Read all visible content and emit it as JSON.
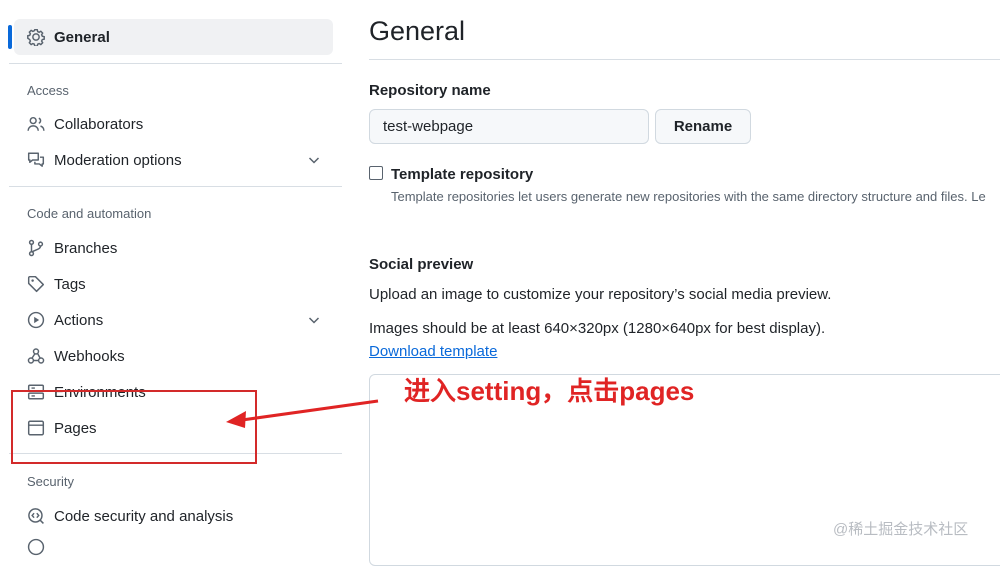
{
  "sidebar": {
    "general": {
      "label": "General"
    },
    "sections": {
      "access": "Access",
      "code_automation": "Code and automation",
      "security": "Security"
    },
    "items": {
      "collaborators": "Collaborators",
      "moderation": "Moderation options",
      "branches": "Branches",
      "tags": "Tags",
      "actions": "Actions",
      "webhooks": "Webhooks",
      "environments": "Environments",
      "pages": "Pages",
      "code_security": "Code security and analysis"
    }
  },
  "main": {
    "title": "General",
    "repo_name_label": "Repository name",
    "repo_name_value": "test-webpage",
    "rename_button": "Rename",
    "template_label": "Template repository",
    "template_help": "Template repositories let users generate new repositories with the same directory structure and files. Le",
    "social_preview_title": "Social preview",
    "social_upload_text": "Upload an image to customize your repository’s social media preview.",
    "social_size_text": "Images should be at least 640×320px (1280×640px for best display).",
    "download_link": "Download template"
  },
  "annotation": {
    "text": "进入setting，点击pages",
    "color": "#e02424"
  },
  "watermark": "@稀土掘金技术社区",
  "colors": {
    "accent": "#0969da",
    "annotation": "#e02424"
  }
}
